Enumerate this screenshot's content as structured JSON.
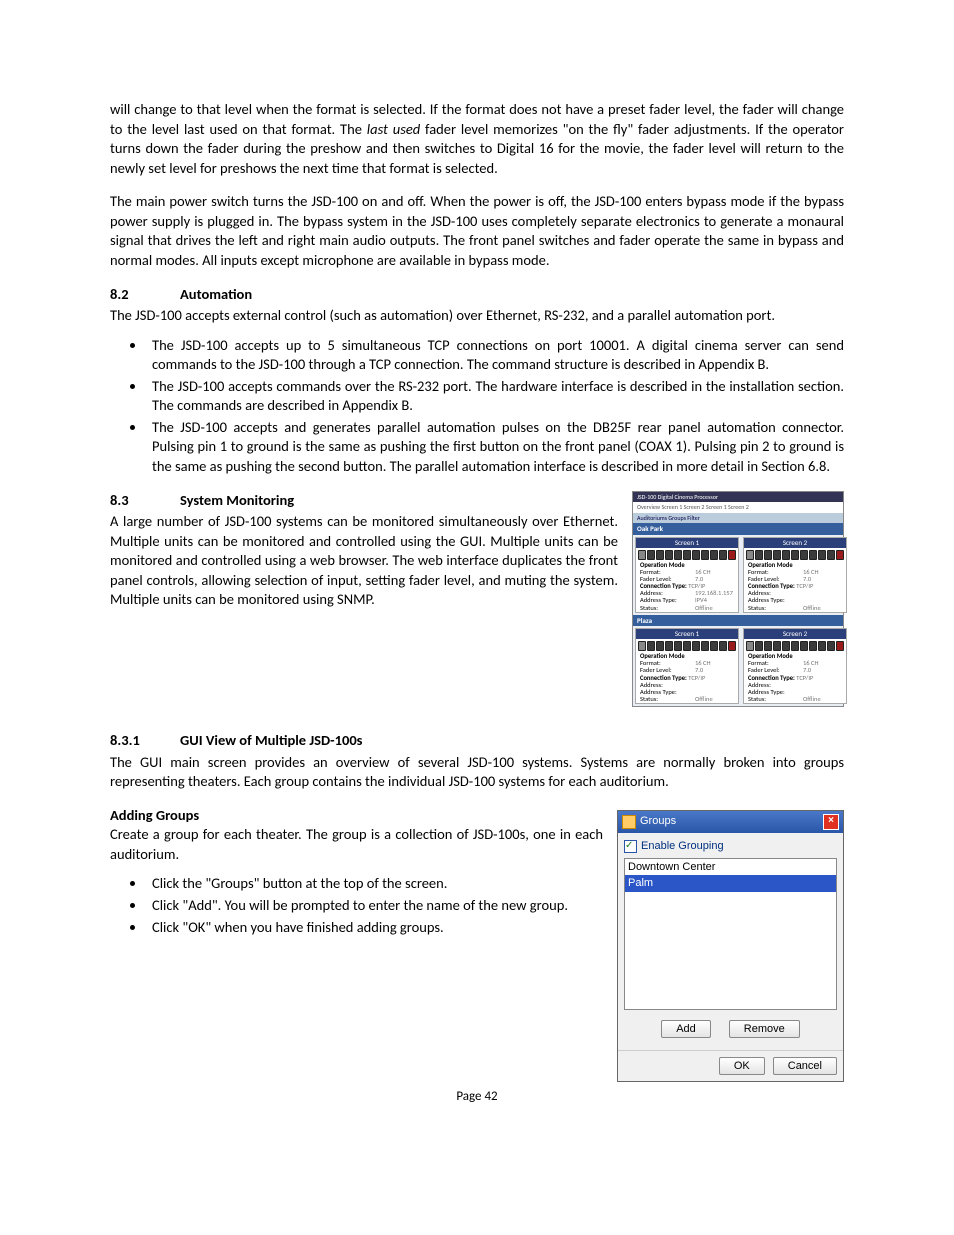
{
  "paragraphs": {
    "p1a": "will change to that level when the format is selected.  If the format does not have a preset fader level, the fader will change to the level last used on that format.  The ",
    "p1_italic": "last used",
    "p1b": " fader level memorizes \"on the fly\" fader adjustments.  If the operator turns down the fader during the preshow and then switches to Digital 16 for the movie, the fader level will return to the newly set level for preshows the next time that format is selected.",
    "p2": "The main power switch turns the JSD-100 on and off.  When the power is off, the JSD-100 enters bypass mode if the bypass power supply is plugged in.  The bypass system in the JSD-100 uses completely separate electronics to generate a monaural signal that drives the left and right main audio outputs.  The front panel switches and fader operate the same in bypass and normal modes. All inputs except microphone are available in bypass mode.",
    "s82_intro": "The JSD-100 accepts external control (such as automation) over Ethernet, RS-232, and a parallel automation port.",
    "s83_intro": "A large number of JSD-100 systems can be monitored simultaneously over Ethernet.  Multiple units can be monitored and controlled using the GUI. Multiple units can be monitored and controlled using a web browser. The web interface duplicates the front panel controls, allowing selection of input, setting fader level, and muting the system. Multiple units can be monitored using SNMP.",
    "s831_intro": "The GUI main screen provides an overview of several JSD-100 systems.  Systems are normally broken into groups representing theaters.  Each group contains the individual JSD-100 systems for each auditorium.",
    "adding_intro": "Create a group for each theater.  The group is a collection of JSD-100s, one in each auditorium."
  },
  "headings": {
    "h82_num": "8.2",
    "h82": "Automation",
    "h83_num": "8.3",
    "h83": "System Monitoring",
    "h831_num": "8.3.1",
    "h831": "GUI View of Multiple JSD-100s",
    "adding": "Adding Groups"
  },
  "bullets_82": [
    "The JSD-100 accepts up to 5 simultaneous TCP connections on port 10001.  A digital cinema server can send commands to the JSD-100 through a TCP connection. The command structure is described in Appendix B.",
    "The JSD-100 accepts commands over the RS-232 port. The hardware interface is described in the installation section. The commands are described in Appendix B.",
    "The JSD-100 accepts and generates parallel automation pulses on the DB25F rear panel automation connector. Pulsing pin 1 to ground is the same as pushing the first button on the front panel (COAX 1).  Pulsing pin 2 to ground is the same as pushing the second button.  The parallel automation interface is described in more detail in Section 6.8."
  ],
  "bullets_adding": [
    "Click the \"Groups\" button at the top of the screen.",
    "Click \"Add\".  You will be prompted to enter the name of the new group.",
    "Click \"OK\" when you have finished adding groups."
  ],
  "fig1": {
    "window_title": "JSD-100 Digital Cinema Processor",
    "tabs": "Overview   Screen 1   Screen 2   Screen 1   Screen 2",
    "toolbar": "Auditoriums    Groups    Filter",
    "group1": "Oak Park",
    "group2": "Plaza",
    "screen1": "Screen 1",
    "screen2": "Screen 2",
    "labels": {
      "opmode": "Operation Mode",
      "format": "Format:",
      "fader": "Fader Level:",
      "conn": "Connection Type:",
      "addr": "Address:",
      "addrtype": "Address Type:",
      "status": "Status:"
    },
    "oak_s1": {
      "format": "16 CH",
      "fader": "7.0",
      "conn": "TCP/IP",
      "addr": "192.168.1.157",
      "addrtype": "IPV4",
      "status": "Offline"
    },
    "oak_s2": {
      "format": "16 CH",
      "fader": "7.0",
      "conn": "TCP/IP",
      "addr": "",
      "addrtype": "",
      "status": "Offline"
    },
    "plaza_s1": {
      "format": "16 CH",
      "fader": "7.0",
      "conn": "TCP/IP",
      "addr": "",
      "addrtype": "",
      "status": "Offline"
    },
    "plaza_s2": {
      "format": "16 CH",
      "fader": "7.0",
      "conn": "TCP/IP",
      "addr": "",
      "addrtype": "",
      "status": "Offline"
    }
  },
  "fig2": {
    "title": "Groups",
    "enable": "Enable Grouping",
    "items": [
      "Downtown Center",
      "Palm"
    ],
    "add": "Add",
    "remove": "Remove",
    "ok": "OK",
    "cancel": "Cancel"
  },
  "footer": "Page 42"
}
